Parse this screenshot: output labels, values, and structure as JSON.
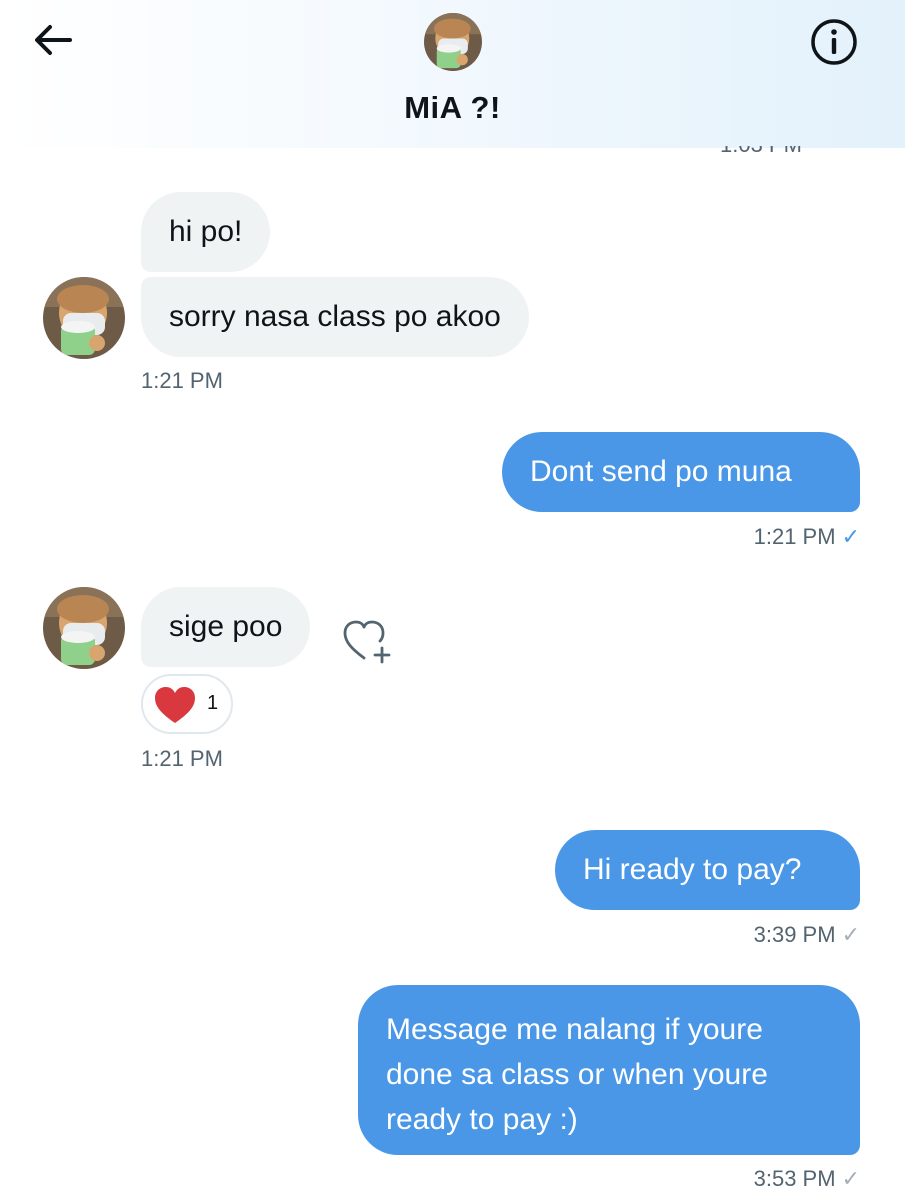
{
  "header": {
    "title": "MiA ?!",
    "back_icon": "arrow-left-icon",
    "info_icon": "info-circle-icon"
  },
  "messages": [
    {
      "direction": "in",
      "text": "hi po!"
    },
    {
      "direction": "in",
      "text": "sorry nasa class po akoo",
      "timestamp": "1:21 PM"
    },
    {
      "direction": "out",
      "text": "Dont send po muna",
      "timestamp": "1:21 PM",
      "status": "read"
    },
    {
      "direction": "in",
      "text": "sige poo",
      "timestamp": "1:21 PM",
      "reaction": {
        "emoji": "heart-icon",
        "count": "1"
      }
    },
    {
      "direction": "out",
      "text": "Hi ready to pay?",
      "timestamp": "3:39 PM",
      "status": "sent"
    },
    {
      "direction": "out",
      "lines": [
        "Message me nalang if youre",
        "done sa class or when youre",
        "ready to pay :)"
      ],
      "timestamp": "3:53 PM",
      "status": "sent"
    }
  ],
  "colors": {
    "outgoing_bubble": "#4a97e8",
    "incoming_bubble": "#eff3f4",
    "read_check": "#4a97e8",
    "sent_check": "#a7afb6",
    "reaction_heart": "#e0245e"
  }
}
